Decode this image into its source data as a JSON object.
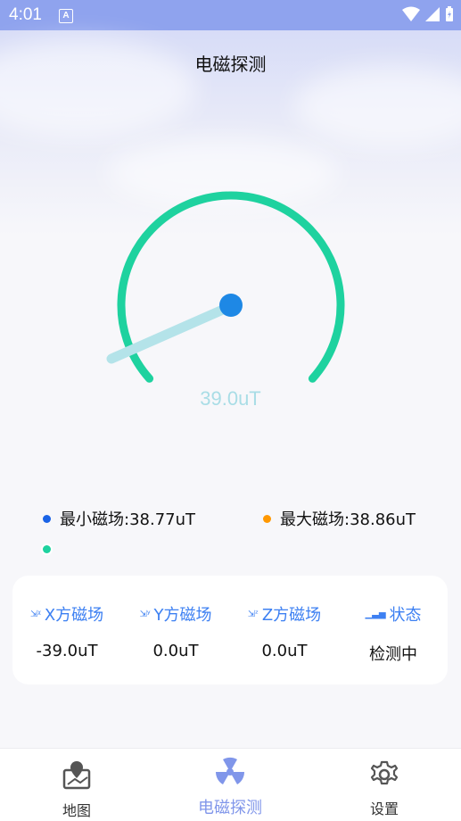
{
  "status_bar": {
    "time": "4:01"
  },
  "header": {
    "title": "电磁探测"
  },
  "gauge": {
    "reading": "39.0uT",
    "value": 39.0,
    "needle_color": "#b4e3e9",
    "arc_color": "#1ed29f",
    "hub_color": "#1e88e5"
  },
  "legend": {
    "min_label": "最小磁场:38.77uT",
    "max_label": "最大磁场:38.86uT",
    "min_color": "#1a63e6",
    "max_color": "#ff9800",
    "current_color": "#1ed29f"
  },
  "axes": [
    {
      "icon": "X-axis-icon",
      "label": "X方磁场",
      "value": "-39.0uT"
    },
    {
      "icon": "Y-axis-icon",
      "label": "Y方磁场",
      "value": "0.0uT"
    },
    {
      "icon": "Z-axis-icon",
      "label": "Z方磁场",
      "value": "0.0uT"
    },
    {
      "icon": "status-bars-icon",
      "label": "状态",
      "value": "检测中"
    }
  ],
  "tabs": [
    {
      "icon": "map-pin-icon",
      "label": "地图"
    },
    {
      "icon": "radiation-icon",
      "label": "电磁探测"
    },
    {
      "icon": "gear-icon",
      "label": "设置"
    }
  ],
  "colors": {
    "accent": "#3d80f2",
    "tab_active": "#8096ea"
  }
}
